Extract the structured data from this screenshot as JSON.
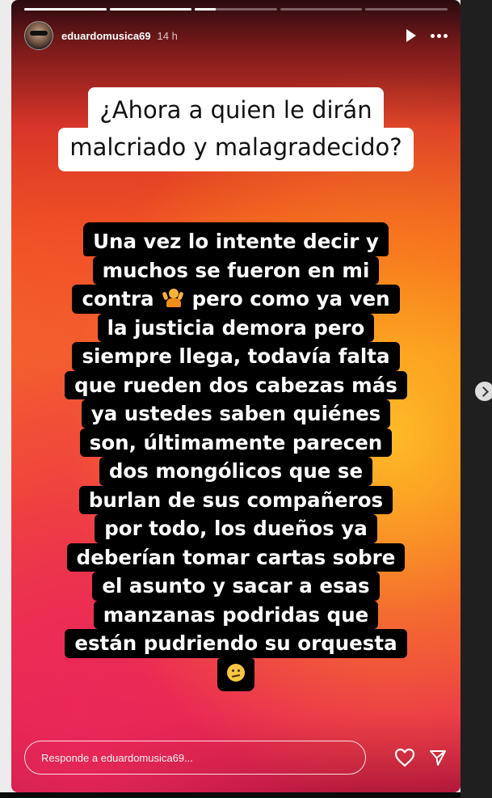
{
  "story": {
    "progress_segments": [
      1,
      1,
      0.25,
      0,
      0
    ],
    "username": "eduardomusica69",
    "time": "14 h",
    "icons": {
      "play": "play-icon",
      "more": "more-icon",
      "heart": "heart-icon",
      "share": "send-icon",
      "next": "chevron-right-icon"
    },
    "question_lines": [
      "¿Ahora a quien le dirán",
      "malcriado y malagradecido?"
    ],
    "body_lines": [
      "Una vez lo intente decir y",
      "muchos se fueron en mi",
      "contra",
      "pero como ya ven",
      "la justicia demora pero",
      "siempre llega, todavía falta",
      "que rueden dos cabezas más",
      "ya ustedes saben quiénes",
      "son, últimamente parecen",
      "dos mongólicos que se",
      "burlan de sus compañeros",
      "por todo, los dueños ya",
      "deberían tomar cartas sobre",
      "el asunto y sacar a esas",
      "manzanas podridas que",
      "están pudriendo su orquesta"
    ],
    "emoji_names": [
      "person-shrugging-emoji",
      "confused-face-emoji"
    ],
    "reply_placeholder": "Responde a eduardomusica69...",
    "colors": {
      "gradient_top": "#d8352a",
      "gradient_mid": "#f7761a",
      "gradient_bottom": "#e8284f",
      "question_bg": "#ffffff",
      "body_bg": "#000000"
    }
  }
}
